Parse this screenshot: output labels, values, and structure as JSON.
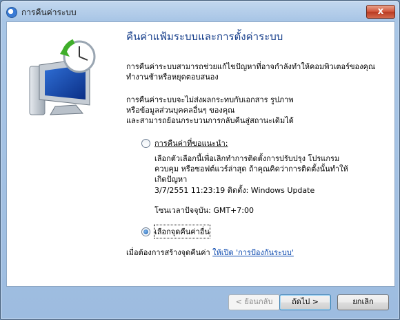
{
  "window": {
    "title": "การคืนค่าระบบ",
    "close_glyph": "x"
  },
  "heading": "คืนค่าแฟ้มระบบและการตั้งค่าระบบ",
  "intro": [
    "การคืนค่าระบบสามารถช่วยแก้ไขปัญหาที่อาจกำลังทำให้คอมพิวเตอร์ของคุณ",
    "ทำงานช้าหรือหยุดตอบสนอง"
  ],
  "note": [
    "การคืนค่าระบบจะไม่ส่งผลกระทบกับเอกสาร รูปภาพ",
    "หรือข้อมูลส่วนบุคคลอื่นๆ ของคุณ",
    "และสามารถย้อนกระบวนการกลับคืนสู่สถานะเดิมได้"
  ],
  "options": {
    "recommended": {
      "label": "การคืนค่าที่ขอแนะนำ:",
      "description": [
        "เลือกตัวเลือกนี้เพื่อเลิกทำการติดตั้งการปรับปรุง โปรแกรม",
        "ควบคุม หรือซอฟต์แวร์ล่าสุด ถ้าคุณคิดว่าการติดตั้งนั้นทำให้",
        "เกิดปัญหา"
      ],
      "restore_point": "3/7/2551 11:23:19 ติดตั้ง: Windows Update",
      "timezone": "โซนเวลาปัจจุบัน: GMT+7:00",
      "selected": false
    },
    "other": {
      "label": "เลือกจุดคืนค่าอื่น",
      "selected": true
    }
  },
  "protection": {
    "prefix": "เมื่อต้องการสร้างจุดคืนค่า ",
    "link": "ให้เปิด 'การป้องกันระบบ'"
  },
  "buttons": {
    "back": "< ย้อนกลับ",
    "next": "ถัดไป >",
    "cancel": "ยกเลิก"
  }
}
